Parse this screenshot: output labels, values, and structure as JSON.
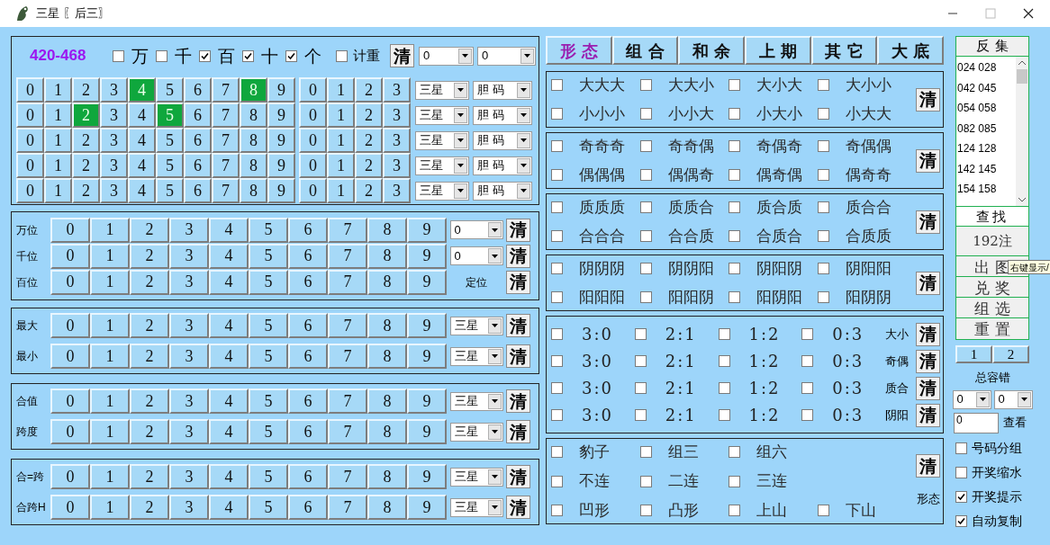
{
  "window": {
    "title": "三星 〖后三〗"
  },
  "filter_panel": {
    "range": "420-468",
    "positions": [
      {
        "label": "万",
        "checked": false
      },
      {
        "label": "千",
        "checked": false
      },
      {
        "label": "百",
        "checked": true
      },
      {
        "label": "十",
        "checked": true
      },
      {
        "label": "个",
        "checked": true
      }
    ],
    "weight": {
      "label": "计重",
      "checked": false
    },
    "clear": "清",
    "dropdowns": [
      "0",
      "0"
    ],
    "rows": [
      {
        "digits": [
          {
            "label": "0",
            "selected": false
          },
          {
            "label": "1",
            "selected": false
          },
          {
            "label": "2",
            "selected": false
          },
          {
            "label": "3",
            "selected": false
          },
          {
            "label": "4",
            "selected": true
          },
          {
            "label": "5",
            "selected": false
          },
          {
            "label": "6",
            "selected": false
          },
          {
            "label": "7",
            "selected": false
          },
          {
            "label": "8",
            "selected": true
          },
          {
            "label": "9",
            "selected": false
          }
        ],
        "extra": [
          {
            "label": "0",
            "selected": false
          },
          {
            "label": "1",
            "selected": false
          },
          {
            "label": "2",
            "selected": false
          },
          {
            "label": "3",
            "selected": false
          }
        ],
        "dropdowns": [
          "三星",
          "胆 码"
        ]
      },
      {
        "digits": [
          {
            "label": "0",
            "selected": false
          },
          {
            "label": "1",
            "selected": false
          },
          {
            "label": "2",
            "selected": true
          },
          {
            "label": "3",
            "selected": false
          },
          {
            "label": "4",
            "selected": false
          },
          {
            "label": "5",
            "selected": true
          },
          {
            "label": "6",
            "selected": false
          },
          {
            "label": "7",
            "selected": false
          },
          {
            "label": "8",
            "selected": false
          },
          {
            "label": "9",
            "selected": false
          }
        ],
        "extra": [
          {
            "label": "0",
            "selected": false
          },
          {
            "label": "1",
            "selected": false
          },
          {
            "label": "2",
            "selected": false
          },
          {
            "label": "3",
            "selected": false
          }
        ],
        "dropdowns": [
          "三星",
          "胆 码"
        ]
      },
      {
        "digits": [
          {
            "label": "0",
            "selected": false
          },
          {
            "label": "1",
            "selected": false
          },
          {
            "label": "2",
            "selected": false
          },
          {
            "label": "3",
            "selected": false
          },
          {
            "label": "4",
            "selected": false
          },
          {
            "label": "5",
            "selected": false
          },
          {
            "label": "6",
            "selected": false
          },
          {
            "label": "7",
            "selected": false
          },
          {
            "label": "8",
            "selected": false
          },
          {
            "label": "9",
            "selected": false
          }
        ],
        "extra": [
          {
            "label": "0",
            "selected": false
          },
          {
            "label": "1",
            "selected": false
          },
          {
            "label": "2",
            "selected": false
          },
          {
            "label": "3",
            "selected": false
          }
        ],
        "dropdowns": [
          "三星",
          "胆 码"
        ]
      },
      {
        "digits": [
          {
            "label": "0",
            "selected": false
          },
          {
            "label": "1",
            "selected": false
          },
          {
            "label": "2",
            "selected": false
          },
          {
            "label": "3",
            "selected": false
          },
          {
            "label": "4",
            "selected": false
          },
          {
            "label": "5",
            "selected": false
          },
          {
            "label": "6",
            "selected": false
          },
          {
            "label": "7",
            "selected": false
          },
          {
            "label": "8",
            "selected": false
          },
          {
            "label": "9",
            "selected": false
          }
        ],
        "extra": [
          {
            "label": "0",
            "selected": false
          },
          {
            "label": "1",
            "selected": false
          },
          {
            "label": "2",
            "selected": false
          },
          {
            "label": "3",
            "selected": false
          }
        ],
        "dropdowns": [
          "三星",
          "胆 码"
        ]
      },
      {
        "digits": [
          {
            "label": "0",
            "selected": false
          },
          {
            "label": "1",
            "selected": false
          },
          {
            "label": "2",
            "selected": false
          },
          {
            "label": "3",
            "selected": false
          },
          {
            "label": "4",
            "selected": false
          },
          {
            "label": "5",
            "selected": false
          },
          {
            "label": "6",
            "selected": false
          },
          {
            "label": "7",
            "selected": false
          },
          {
            "label": "8",
            "selected": false
          },
          {
            "label": "9",
            "selected": false
          }
        ],
        "extra": [
          {
            "label": "0",
            "selected": false
          },
          {
            "label": "1",
            "selected": false
          },
          {
            "label": "2",
            "selected": false
          },
          {
            "label": "3",
            "selected": false
          }
        ],
        "dropdowns": [
          "三星",
          "胆 码"
        ]
      }
    ]
  },
  "position_panel": {
    "rows": [
      {
        "label": "万位",
        "digits": [
          {
            "label": "0",
            "selected": false
          },
          {
            "label": "1",
            "selected": false
          },
          {
            "label": "2",
            "selected": false
          },
          {
            "label": "3",
            "selected": false
          },
          {
            "label": "4",
            "selected": false
          },
          {
            "label": "5",
            "selected": false
          },
          {
            "label": "6",
            "selected": false
          },
          {
            "label": "7",
            "selected": false
          },
          {
            "label": "8",
            "selected": false
          },
          {
            "label": "9",
            "selected": false
          }
        ],
        "kind": "dropdown",
        "dropdown": "0",
        "clear": "清"
      },
      {
        "label": "千位",
        "digits": [
          {
            "label": "0",
            "selected": false
          },
          {
            "label": "1",
            "selected": false
          },
          {
            "label": "2",
            "selected": false
          },
          {
            "label": "3",
            "selected": false
          },
          {
            "label": "4",
            "selected": false
          },
          {
            "label": "5",
            "selected": false
          },
          {
            "label": "6",
            "selected": false
          },
          {
            "label": "7",
            "selected": false
          },
          {
            "label": "8",
            "selected": false
          },
          {
            "label": "9",
            "selected": false
          }
        ],
        "kind": "dropdown",
        "dropdown": "0",
        "clear": "清"
      },
      {
        "label": "百位",
        "digits": [
          {
            "label": "0",
            "selected": false
          },
          {
            "label": "1",
            "selected": false
          },
          {
            "label": "2",
            "selected": false
          },
          {
            "label": "3",
            "selected": false
          },
          {
            "label": "4",
            "selected": false
          },
          {
            "label": "5",
            "selected": false
          },
          {
            "label": "6",
            "selected": false
          },
          {
            "label": "7",
            "selected": false
          },
          {
            "label": "8",
            "selected": false
          },
          {
            "label": "9",
            "selected": false
          }
        ],
        "kind": "label",
        "text": "定位",
        "clear": "清"
      }
    ]
  },
  "value_panels": [
    {
      "rows": [
        {
          "label": "最大",
          "digits": [
            {
              "label": "0",
              "selected": false
            },
            {
              "label": "1",
              "selected": false
            },
            {
              "label": "2",
              "selected": false
            },
            {
              "label": "3",
              "selected": false
            },
            {
              "label": "4",
              "selected": false
            },
            {
              "label": "5",
              "selected": false
            },
            {
              "label": "6",
              "selected": false
            },
            {
              "label": "7",
              "selected": false
            },
            {
              "label": "8",
              "selected": false
            },
            {
              "label": "9",
              "selected": false
            }
          ],
          "dropdown": "三星",
          "clear": "清"
        },
        {
          "label": "最小",
          "digits": [
            {
              "label": "0",
              "selected": false
            },
            {
              "label": "1",
              "selected": false
            },
            {
              "label": "2",
              "selected": false
            },
            {
              "label": "3",
              "selected": false
            },
            {
              "label": "4",
              "selected": false
            },
            {
              "label": "5",
              "selected": false
            },
            {
              "label": "6",
              "selected": false
            },
            {
              "label": "7",
              "selected": false
            },
            {
              "label": "8",
              "selected": false
            },
            {
              "label": "9",
              "selected": false
            }
          ],
          "dropdown": "三星",
          "clear": "清"
        }
      ]
    },
    {
      "rows": [
        {
          "label": "合值",
          "digits": [
            {
              "label": "0",
              "selected": false
            },
            {
              "label": "1",
              "selected": false
            },
            {
              "label": "2",
              "selected": false
            },
            {
              "label": "3",
              "selected": false
            },
            {
              "label": "4",
              "selected": false
            },
            {
              "label": "5",
              "selected": false
            },
            {
              "label": "6",
              "selected": false
            },
            {
              "label": "7",
              "selected": false
            },
            {
              "label": "8",
              "selected": false
            },
            {
              "label": "9",
              "selected": false
            }
          ],
          "dropdown": "三星",
          "clear": "清"
        },
        {
          "label": "跨度",
          "digits": [
            {
              "label": "0",
              "selected": false
            },
            {
              "label": "1",
              "selected": false
            },
            {
              "label": "2",
              "selected": false
            },
            {
              "label": "3",
              "selected": false
            },
            {
              "label": "4",
              "selected": false
            },
            {
              "label": "5",
              "selected": false
            },
            {
              "label": "6",
              "selected": false
            },
            {
              "label": "7",
              "selected": false
            },
            {
              "label": "8",
              "selected": false
            },
            {
              "label": "9",
              "selected": false
            }
          ],
          "dropdown": "三星",
          "clear": "清"
        }
      ]
    },
    {
      "rows": [
        {
          "label": "合=跨",
          "digits": [
            {
              "label": "0",
              "selected": false
            },
            {
              "label": "1",
              "selected": false
            },
            {
              "label": "2",
              "selected": false
            },
            {
              "label": "3",
              "selected": false
            },
            {
              "label": "4",
              "selected": false
            },
            {
              "label": "5",
              "selected": false
            },
            {
              "label": "6",
              "selected": false
            },
            {
              "label": "7",
              "selected": false
            },
            {
              "label": "8",
              "selected": false
            },
            {
              "label": "9",
              "selected": false
            }
          ],
          "dropdown": "三星",
          "clear": "清"
        },
        {
          "label": "合跨H",
          "digits": [
            {
              "label": "0",
              "selected": false
            },
            {
              "label": "1",
              "selected": false
            },
            {
              "label": "2",
              "selected": false
            },
            {
              "label": "3",
              "selected": false
            },
            {
              "label": "4",
              "selected": false
            },
            {
              "label": "5",
              "selected": false
            },
            {
              "label": "6",
              "selected": false
            },
            {
              "label": "7",
              "selected": false
            },
            {
              "label": "8",
              "selected": false
            },
            {
              "label": "9",
              "selected": false
            }
          ],
          "dropdown": "三星",
          "clear": "清"
        }
      ]
    }
  ],
  "tabs": [
    {
      "label": "形 态",
      "selected": true
    },
    {
      "label": "组 合",
      "selected": false
    },
    {
      "label": "和 余",
      "selected": false
    },
    {
      "label": "上 期",
      "selected": false
    },
    {
      "label": "其 它",
      "selected": false
    },
    {
      "label": "大 底",
      "selected": false
    }
  ],
  "pattern_groups": [
    {
      "options": [
        {
          "label": "大大大",
          "checked": false
        },
        {
          "label": "大大小",
          "checked": false
        },
        {
          "label": "大小大",
          "checked": false
        },
        {
          "label": "大小小",
          "checked": false
        },
        {
          "label": "小小小",
          "checked": false
        },
        {
          "label": "小小大",
          "checked": false
        },
        {
          "label": "小大小",
          "checked": false
        },
        {
          "label": "小大大",
          "checked": false
        }
      ],
      "clear": "清"
    },
    {
      "options": [
        {
          "label": "奇奇奇",
          "checked": false
        },
        {
          "label": "奇奇偶",
          "checked": false
        },
        {
          "label": "奇偶奇",
          "checked": false
        },
        {
          "label": "奇偶偶",
          "checked": false
        },
        {
          "label": "偶偶偶",
          "checked": false
        },
        {
          "label": "偶偶奇",
          "checked": false
        },
        {
          "label": "偶奇偶",
          "checked": false
        },
        {
          "label": "偶奇奇",
          "checked": false
        }
      ],
      "clear": "清"
    },
    {
      "options": [
        {
          "label": "质质质",
          "checked": false
        },
        {
          "label": "质质合",
          "checked": false
        },
        {
          "label": "质合质",
          "checked": false
        },
        {
          "label": "质合合",
          "checked": false
        },
        {
          "label": "合合合",
          "checked": false
        },
        {
          "label": "合合质",
          "checked": false
        },
        {
          "label": "合质合",
          "checked": false
        },
        {
          "label": "合质质",
          "checked": false
        }
      ],
      "clear": "清"
    },
    {
      "options": [
        {
          "label": "阴阴阴",
          "checked": false
        },
        {
          "label": "阴阴阳",
          "checked": false
        },
        {
          "label": "阴阳阴",
          "checked": false
        },
        {
          "label": "阴阳阳",
          "checked": false
        },
        {
          "label": "阳阳阳",
          "checked": false
        },
        {
          "label": "阳阳阴",
          "checked": false
        },
        {
          "label": "阳阴阳",
          "checked": false
        },
        {
          "label": "阳阴阴",
          "checked": false
        }
      ],
      "clear": "清"
    }
  ],
  "ratio_panel": {
    "rows": [
      {
        "options": [
          {
            "label": "3:0",
            "checked": false
          },
          {
            "label": "2:1",
            "checked": false
          },
          {
            "label": "1:2",
            "checked": false
          },
          {
            "label": "0:3",
            "checked": false
          }
        ],
        "label": "大小",
        "clear": "清"
      },
      {
        "options": [
          {
            "label": "3:0",
            "checked": false
          },
          {
            "label": "2:1",
            "checked": false
          },
          {
            "label": "1:2",
            "checked": false
          },
          {
            "label": "0:3",
            "checked": false
          }
        ],
        "label": "奇偶",
        "clear": "清"
      },
      {
        "options": [
          {
            "label": "3:0",
            "checked": false
          },
          {
            "label": "2:1",
            "checked": false
          },
          {
            "label": "1:2",
            "checked": false
          },
          {
            "label": "0:3",
            "checked": false
          }
        ],
        "label": "质合",
        "clear": "清"
      },
      {
        "options": [
          {
            "label": "3:0",
            "checked": false
          },
          {
            "label": "2:1",
            "checked": false
          },
          {
            "label": "1:2",
            "checked": false
          },
          {
            "label": "0:3",
            "checked": false
          }
        ],
        "label": "阴阳",
        "clear": "清"
      }
    ]
  },
  "shape_panel": {
    "rows": [
      [
        {
          "label": "豹子",
          "checked": false
        },
        {
          "label": "组三",
          "checked": false
        },
        {
          "label": "组六",
          "checked": false
        }
      ],
      [
        {
          "label": "不连",
          "checked": false
        },
        {
          "label": "二连",
          "checked": false
        },
        {
          "label": "三连",
          "checked": false
        }
      ],
      [
        {
          "label": "凹形",
          "checked": false
        },
        {
          "label": "凸形",
          "checked": false
        },
        {
          "label": "上山",
          "checked": false
        },
        {
          "label": "下山",
          "checked": false
        }
      ]
    ],
    "clear": "清",
    "label": "形态"
  },
  "result_panel": {
    "header": "反集",
    "list": [
      "024 028",
      "042 045",
      "054 058",
      "082 085",
      "124 128",
      "142 145",
      "154 158"
    ],
    "search": "查找",
    "count": "192注",
    "buttons": [
      "出 图",
      "兑 奖",
      "组 选",
      "重 置"
    ],
    "page_buttons": [
      "1",
      "2"
    ],
    "tolerance_label": "总容错",
    "tolerance_dropdowns": [
      "0",
      "0"
    ],
    "view": {
      "value": "0",
      "label": "查看"
    },
    "options": [
      {
        "label": "号码分组",
        "checked": false
      },
      {
        "label": "开奖缩水",
        "checked": false
      },
      {
        "label": "开奖提示",
        "checked": true
      },
      {
        "label": "自动复制",
        "checked": true
      }
    ]
  },
  "tooltip": "右键显示/"
}
